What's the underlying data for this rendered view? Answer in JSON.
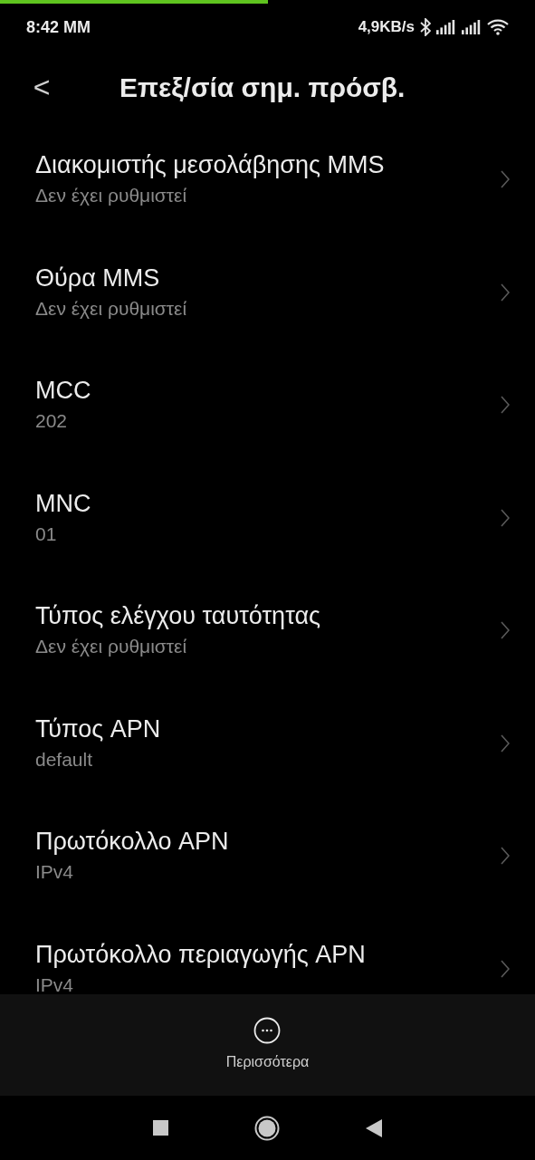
{
  "progress": {
    "level": 0.5
  },
  "status_bar": {
    "time": "8:42 ΜΜ",
    "speed": "4,9KB/s"
  },
  "header": {
    "back": "<",
    "title": "Επεξ/σία σημ. πρόσβ."
  },
  "items": [
    {
      "title": "Διακομιστής μεσολάβησης MMS",
      "value": "Δεν έχει ρυθμιστεί"
    },
    {
      "title": "Θύρα MMS",
      "value": "Δεν έχει ρυθμιστεί"
    },
    {
      "title": "MCC",
      "value": "202"
    },
    {
      "title": "MNC",
      "value": "01"
    },
    {
      "title": "Τύπος ελέγχου ταυτότητας",
      "value": "Δεν έχει ρυθμιστεί"
    },
    {
      "title": "Τύπος APN",
      "value": "default"
    },
    {
      "title": "Πρωτόκολλο APN",
      "value": "IPv4"
    },
    {
      "title": "Πρωτόκολλο περιαγωγής APN",
      "value": "IPv4"
    }
  ],
  "bottom_action": {
    "label": "Περισσότερα"
  }
}
